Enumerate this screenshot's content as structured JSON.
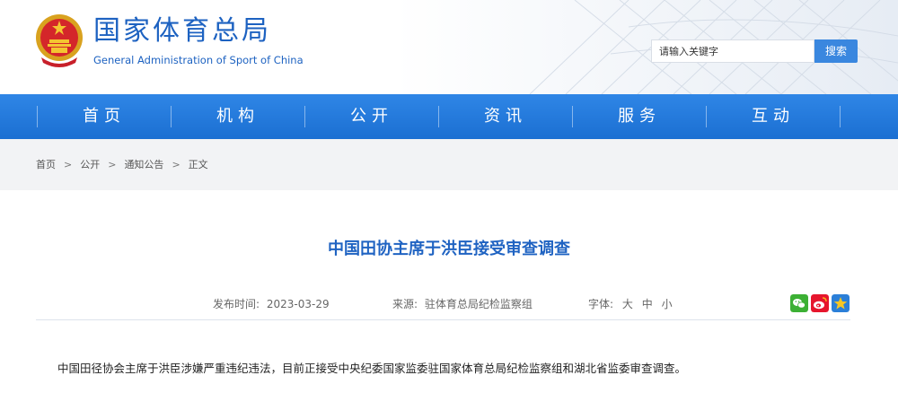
{
  "header": {
    "site_title": "国家体育总局",
    "site_subtitle": "General Administration of Sport of China",
    "search_placeholder": "请输入关键字",
    "search_button": "搜索"
  },
  "nav": {
    "items": [
      {
        "label": "首页"
      },
      {
        "label": "机构"
      },
      {
        "label": "公开"
      },
      {
        "label": "资讯"
      },
      {
        "label": "服务"
      },
      {
        "label": "互动"
      }
    ]
  },
  "breadcrumb": {
    "items": [
      "首页",
      "公开",
      "通知公告",
      "正文"
    ],
    "separator": ">"
  },
  "article": {
    "title": "中国田协主席于洪臣接受审查调查",
    "publish_label": "发布时间:",
    "publish_date": "2023-03-29",
    "source_label": "来源:",
    "source_value": "驻体育总局纪检监察组",
    "font_label": "字体:",
    "font_sizes": [
      "大",
      "中",
      "小"
    ],
    "body": "中国田径协会主席于洪臣涉嫌严重违纪违法，目前正接受中央纪委国家监委驻国家体育总局纪检监察组和湖北省监委审查调查。"
  },
  "share": {
    "icons": [
      "wechat-icon",
      "weibo-icon",
      "favorite-star-icon"
    ]
  },
  "colors": {
    "brand_blue": "#1d62c1",
    "nav_blue": "#2677dc",
    "search_button": "#3a87df",
    "crumb_bg": "#f2f3f5"
  }
}
